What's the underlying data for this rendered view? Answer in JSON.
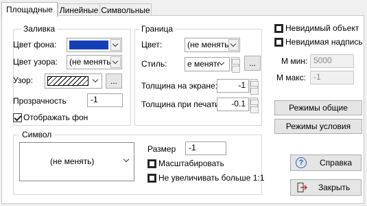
{
  "tabs": [
    "Площадные",
    "Линейные",
    "Символьные"
  ],
  "fill": {
    "legend": "Заливка",
    "bg_color_label": "Цвет фона:",
    "bg_color_value": "#1540b8",
    "pattern_color_label": "Цвет узора:",
    "pattern_color_value": "(не менять)",
    "pattern_label": "Узор:",
    "pattern_button": "...",
    "transparency_label": "Прозрачность",
    "transparency_value": "-1",
    "show_bg_label": "Отображать фон",
    "show_bg_checked": true
  },
  "border": {
    "legend": "Граница",
    "color_label": "Цвет:",
    "color_value": "(не менять)",
    "style_label": "Стиль:",
    "style_value": "е меняте",
    "style_button": "...",
    "screen_width_label": "Толщина на экране:",
    "screen_width_value": "-1",
    "print_width_label": "Толщина при печати:",
    "print_width_value": "-0.1"
  },
  "symbol": {
    "legend": "Символ",
    "value": "(не менять)",
    "size_label": "Размер",
    "size_value": "-1",
    "scale_label": "Масштабировать",
    "no_enlarge_label": "Не увеличивать больше 1:1"
  },
  "right": {
    "invisible_object": "Невидимый объект",
    "invisible_label": "Невидимая надпись",
    "mmin_label": "М мин:",
    "mmin_value": "5000",
    "mmax_label": "М макс:",
    "mmax_value": "-1",
    "modes_general": "Режимы общие",
    "modes_condition": "Режимы условия",
    "help": "Справка",
    "close": "Закрыть"
  }
}
